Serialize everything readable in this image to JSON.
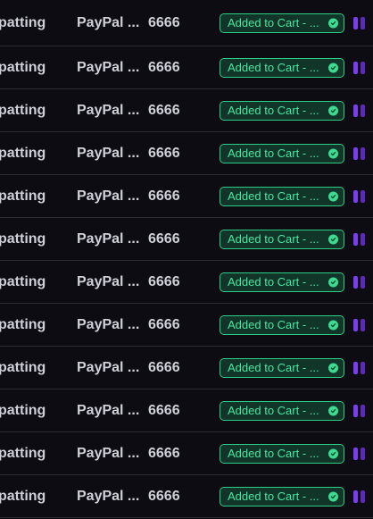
{
  "colors": {
    "background": "#0c0c12",
    "row_divider": "#2a2b35",
    "text": "#cfd0d8",
    "badge_border": "#2fce86",
    "badge_background": "#113528",
    "badge_text": "#49e6a0",
    "handle_purple": "#7c3cf0"
  },
  "rows": [
    {
      "name": "patting",
      "payment": "PayPal ...",
      "quantity": "6666",
      "status": "Added to Cart - ...",
      "status_icon": "check-circle-icon"
    },
    {
      "name": "patting",
      "payment": "PayPal ...",
      "quantity": "6666",
      "status": "Added to Cart - ...",
      "status_icon": "check-circle-icon"
    },
    {
      "name": "patting",
      "payment": "PayPal ...",
      "quantity": "6666",
      "status": "Added to Cart - ...",
      "status_icon": "check-circle-icon"
    },
    {
      "name": "patting",
      "payment": "PayPal ...",
      "quantity": "6666",
      "status": "Added to Cart - ...",
      "status_icon": "check-circle-icon"
    },
    {
      "name": "patting",
      "payment": "PayPal ...",
      "quantity": "6666",
      "status": "Added to Cart - ...",
      "status_icon": "check-circle-icon"
    },
    {
      "name": "patting",
      "payment": "PayPal ...",
      "quantity": "6666",
      "status": "Added to Cart - ...",
      "status_icon": "check-circle-icon"
    },
    {
      "name": "patting",
      "payment": "PayPal ...",
      "quantity": "6666",
      "status": "Added to Cart - ...",
      "status_icon": "check-circle-icon"
    },
    {
      "name": "patting",
      "payment": "PayPal ...",
      "quantity": "6666",
      "status": "Added to Cart - ...",
      "status_icon": "check-circle-icon"
    },
    {
      "name": "patting",
      "payment": "PayPal ...",
      "quantity": "6666",
      "status": "Added to Cart - ...",
      "status_icon": "check-circle-icon"
    },
    {
      "name": "patting",
      "payment": "PayPal ...",
      "quantity": "6666",
      "status": "Added to Cart - ...",
      "status_icon": "check-circle-icon"
    },
    {
      "name": "patting",
      "payment": "PayPal ...",
      "quantity": "6666",
      "status": "Added to Cart - ...",
      "status_icon": "check-circle-icon"
    },
    {
      "name": "patting",
      "payment": "PayPal ...",
      "quantity": "6666",
      "status": "Added to Cart - ...",
      "status_icon": "check-circle-icon"
    }
  ]
}
